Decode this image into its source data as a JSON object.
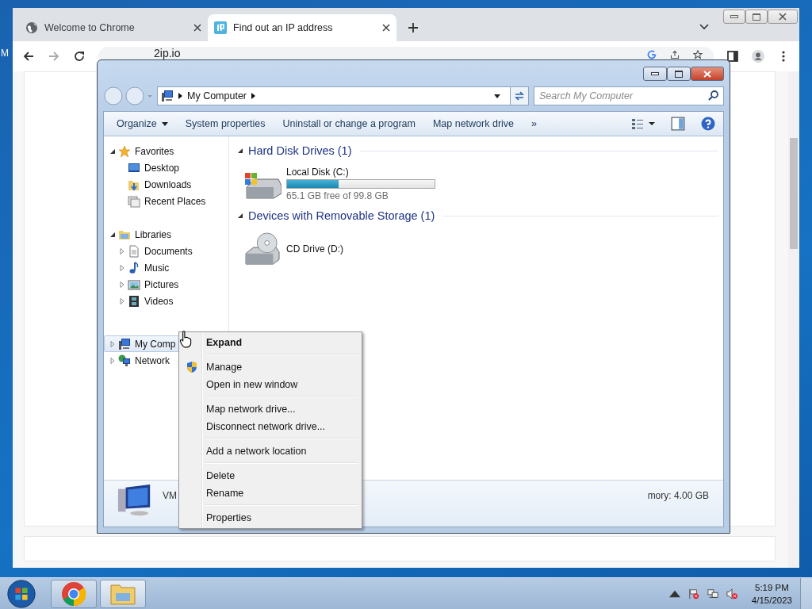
{
  "desktop": {
    "icon_label": "M"
  },
  "browser": {
    "tabs": [
      {
        "title": "Welcome to Chrome",
        "selected": false
      },
      {
        "title": "Find out an IP address",
        "selected": true
      }
    ],
    "address": "2ip.io"
  },
  "explorer": {
    "breadcrumb": "My Computer",
    "search": {
      "placeholder": "Search My Computer"
    },
    "commands": [
      "Organize",
      "System properties",
      "Uninstall or change a program",
      "Map network drive"
    ],
    "overflow": "»",
    "nav": [
      {
        "label": "Favorites",
        "expanded": true,
        "selected": false,
        "children": [
          {
            "label": "Desktop",
            "selected": false
          },
          {
            "label": "Downloads",
            "selected": false
          },
          {
            "label": "Recent Places",
            "selected": false
          }
        ]
      },
      {
        "label": "Libraries",
        "expanded": true,
        "selected": false,
        "children": [
          {
            "label": "Documents",
            "expanded": false,
            "selected": false
          },
          {
            "label": "Music",
            "expanded": false,
            "selected": false
          },
          {
            "label": "Pictures",
            "expanded": false,
            "selected": false
          },
          {
            "label": "Videos",
            "expanded": false,
            "selected": false
          }
        ]
      },
      {
        "label": "My Comp",
        "expanded": false,
        "selected": true
      },
      {
        "label": "Network",
        "expanded": false,
        "selected": false
      }
    ],
    "groups": [
      {
        "title": "Hard Disk Drives (1)",
        "expanded": true,
        "items": [
          {
            "kind": "disk",
            "name": "Local Disk (C:)",
            "level": 0.35,
            "free": "65.1 GB free of 99.8 GB"
          }
        ]
      },
      {
        "title": "Devices with Removable Storage (1)",
        "expanded": true,
        "items": [
          {
            "kind": "cd",
            "name": "CD Drive (D:)"
          }
        ]
      }
    ],
    "details": {
      "name": "VM",
      "memory": "mory: 4.00 GB"
    }
  },
  "context_menu": [
    [
      {
        "label": "Expand",
        "bold": true,
        "shield": false
      }
    ],
    [
      {
        "label": "Manage",
        "bold": false,
        "shield": true
      },
      {
        "label": "Open in new window",
        "bold": false,
        "shield": false
      }
    ],
    [
      {
        "label": "Map network drive...",
        "bold": false,
        "shield": false
      },
      {
        "label": "Disconnect network drive...",
        "bold": false,
        "shield": false
      }
    ],
    [
      {
        "label": "Add a network location",
        "bold": false,
        "shield": false
      }
    ],
    [
      {
        "label": "Delete",
        "bold": false,
        "shield": false
      },
      {
        "label": "Rename",
        "bold": false,
        "shield": false
      }
    ],
    [
      {
        "label": "Properties",
        "bold": false,
        "shield": false
      }
    ]
  ],
  "taskbar": {
    "time": "5:19 PM",
    "date": "4/15/2023"
  }
}
